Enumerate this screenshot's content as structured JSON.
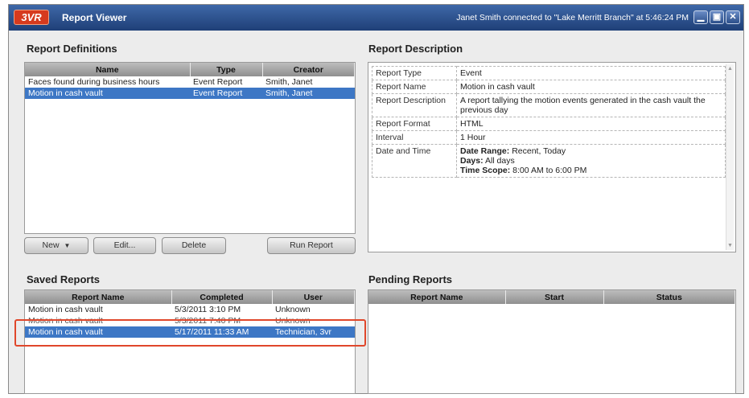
{
  "titlebar": {
    "logo": "3VR",
    "title": "Report Viewer",
    "status": "Janet Smith connected to \"Lake Merritt Branch\" at 5:46:24 PM"
  },
  "definitions": {
    "heading": "Report Definitions",
    "columns": [
      "Name",
      "Type",
      "Creator"
    ],
    "rows": [
      {
        "name": "Faces found during business hours",
        "type": "Event Report",
        "creator": "Smith, Janet"
      },
      {
        "name": "Motion in cash vault",
        "type": "Event Report",
        "creator": "Smith, Janet",
        "selected": true
      }
    ],
    "buttons": {
      "new": "New",
      "edit": "Edit...",
      "delete": "Delete",
      "run": "Run Report"
    }
  },
  "description": {
    "heading": "Report Description",
    "rows": [
      {
        "key": "Report Type",
        "value": "Event"
      },
      {
        "key": "Report Name",
        "value": "Motion in cash vault"
      },
      {
        "key": "Report Description",
        "value": "A report tallying the motion events generated in the cash vault the previous day"
      },
      {
        "key": "Report Format",
        "value": "HTML"
      },
      {
        "key": "Interval",
        "value": "1 Hour"
      }
    ],
    "datetime": {
      "key": "Date and Time",
      "range_label": "Date Range:",
      "range_value": "Recent, Today",
      "days_label": "Days:",
      "days_value": "All days",
      "scope_label": "Time Scope:",
      "scope_value": "8:00 AM to 6:00 PM"
    }
  },
  "saved": {
    "heading": "Saved Reports",
    "columns": [
      "Report Name",
      "Completed",
      "User"
    ],
    "rows": [
      {
        "name": "Motion in cash vault",
        "completed": "5/3/2011 3:10 PM",
        "user": "Unknown"
      },
      {
        "name": "Motion in cash vault",
        "completed": "5/3/2011 7:40 PM",
        "user": "Unknown",
        "strike": true
      },
      {
        "name": "Motion in cash vault",
        "completed": "5/17/2011 11:33 AM",
        "user": "Technician, 3vr",
        "selected": true
      }
    ]
  },
  "pending": {
    "heading": "Pending Reports",
    "columns": [
      "Report Name",
      "Start",
      "Status"
    ]
  }
}
